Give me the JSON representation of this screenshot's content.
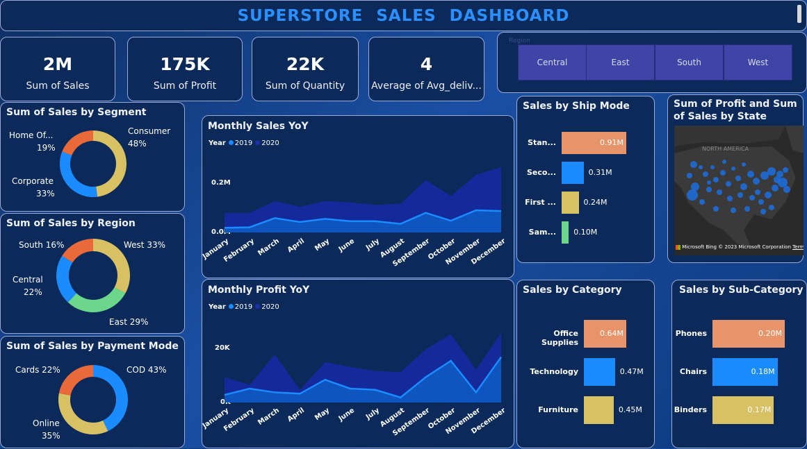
{
  "header": {
    "title": "SUPERSTORE SALES DASHBOARD"
  },
  "kpis": [
    {
      "value": "2M",
      "label": "Sum of Sales"
    },
    {
      "value": "175K",
      "label": "Sum of Profit"
    },
    {
      "value": "22K",
      "label": "Sum of Quantity"
    },
    {
      "value": "4",
      "label": "Average of Avg_deliv..."
    }
  ],
  "region_slicer": {
    "label": "Region",
    "options": [
      "Central",
      "East",
      "South",
      "West"
    ]
  },
  "segment_chart": {
    "title": "Sum of Sales by Segment",
    "slices": [
      {
        "name": "Consumer",
        "pct": "48%",
        "value": 48,
        "color": "#d8c064"
      },
      {
        "name": "Corporate",
        "pct": "33%",
        "value": 33,
        "color": "#1a8cff"
      },
      {
        "name": "Home Of...",
        "pct": "19%",
        "value": 19,
        "color": "#e8693a"
      }
    ]
  },
  "region_chart": {
    "title": "Sum of Sales by Region",
    "slices": [
      {
        "name": "West",
        "pct": "33%",
        "value": 33,
        "color": "#d8c064"
      },
      {
        "name": "East",
        "pct": "29%",
        "value": 29,
        "color": "#6cd68a"
      },
      {
        "name": "Central",
        "pct": "22%",
        "value": 22,
        "color": "#1a8cff"
      },
      {
        "name": "South",
        "pct": "16%",
        "value": 16,
        "color": "#e8693a"
      }
    ]
  },
  "payment_chart": {
    "title": "Sum of Sales by Payment Mode",
    "slices": [
      {
        "name": "COD",
        "pct": "43%",
        "value": 43,
        "color": "#1a8cff"
      },
      {
        "name": "Online",
        "pct": "35%",
        "value": 35,
        "color": "#d8c064"
      },
      {
        "name": "Cards",
        "pct": "22%",
        "value": 22,
        "color": "#e8693a"
      }
    ]
  },
  "monthly_sales": {
    "title": "Monthly Sales YoY",
    "legend_title": "Year",
    "series_names": [
      "2019",
      "2020"
    ],
    "months": [
      "January",
      "February",
      "March",
      "April",
      "May",
      "June",
      "July",
      "August",
      "September",
      "October",
      "November",
      "December"
    ],
    "y_ticks": [
      "0.2M",
      "0.0M"
    ],
    "series_2019": [
      0.018,
      0.02,
      0.055,
      0.04,
      0.052,
      0.043,
      0.043,
      0.033,
      0.075,
      0.045,
      0.085,
      0.082
    ],
    "series_2020": [
      0.075,
      0.075,
      0.12,
      0.098,
      0.12,
      0.115,
      0.105,
      0.11,
      0.2,
      0.14,
      0.22,
      0.25
    ]
  },
  "monthly_profit": {
    "title": "Monthly Profit YoY",
    "legend_title": "Year",
    "series_names": [
      "2019",
      "2020"
    ],
    "months": [
      "January",
      "February",
      "March",
      "April",
      "May",
      "June",
      "July",
      "August",
      "September",
      "October",
      "November",
      "December"
    ],
    "y_ticks": [
      "20K",
      "0K"
    ],
    "series_2019": [
      3000,
      5500,
      4000,
      3500,
      9000,
      5500,
      5000,
      2000,
      10000,
      16500,
      4000,
      18000
    ],
    "series_2020": [
      10000,
      7000,
      19000,
      5000,
      16000,
      14000,
      12500,
      12000,
      21000,
      27000,
      13000,
      27500
    ]
  },
  "ship_mode_chart": {
    "title": "Sales by Ship Mode",
    "bars": [
      {
        "name": "Stan...",
        "label": "0.91M",
        "value": 0.91,
        "color": "#e8946a"
      },
      {
        "name": "Seco...",
        "label": "0.31M",
        "value": 0.31,
        "color": "#1a8cff"
      },
      {
        "name": "First ...",
        "label": "0.24M",
        "value": 0.24,
        "color": "#d8c064"
      },
      {
        "name": "Sam...",
        "label": "0.10M",
        "value": 0.1,
        "color": "#6cd68a"
      }
    ]
  },
  "map_chart": {
    "title": "Sum of Profit and Sum of Sales by State",
    "region_label": "NORTH AMERICA",
    "attribution": "© 2023 Microsoft Corporation",
    "brand": "Microsoft Bing",
    "terms": "Terms"
  },
  "category_chart": {
    "title": "Sales by Category",
    "bars": [
      {
        "name": "Office Supplies",
        "label": "0.64M",
        "value": 0.64,
        "color": "#e8946a"
      },
      {
        "name": "Technology",
        "label": "0.47M",
        "value": 0.47,
        "color": "#1a8cff"
      },
      {
        "name": "Furniture",
        "label": "0.45M",
        "value": 0.45,
        "color": "#d8c064"
      }
    ]
  },
  "subcategory_chart": {
    "title": "Sales by Sub-Category",
    "bars": [
      {
        "name": "Phones",
        "label": "0.20M",
        "value": 0.2,
        "color": "#e8946a"
      },
      {
        "name": "Chairs",
        "label": "0.18M",
        "value": 0.18,
        "color": "#1a8cff"
      },
      {
        "name": "Binders",
        "label": "0.17M",
        "value": 0.17,
        "color": "#d8c064"
      }
    ]
  },
  "chart_data": [
    {
      "type": "pie",
      "title": "Sum of Sales by Segment",
      "categories": [
        "Consumer",
        "Corporate",
        "Home Of..."
      ],
      "values": [
        48,
        33,
        19
      ]
    },
    {
      "type": "pie",
      "title": "Sum of Sales by Region",
      "categories": [
        "West",
        "East",
        "Central",
        "South"
      ],
      "values": [
        33,
        29,
        22,
        16
      ]
    },
    {
      "type": "pie",
      "title": "Sum of Sales by Payment Mode",
      "categories": [
        "COD",
        "Online",
        "Cards"
      ],
      "values": [
        43,
        35,
        22
      ]
    },
    {
      "type": "area",
      "title": "Monthly Sales YoY",
      "x": [
        "January",
        "February",
        "March",
        "April",
        "May",
        "June",
        "July",
        "August",
        "September",
        "October",
        "November",
        "December"
      ],
      "series": [
        {
          "name": "2019",
          "values": [
            0.018,
            0.02,
            0.055,
            0.04,
            0.052,
            0.043,
            0.043,
            0.033,
            0.075,
            0.045,
            0.085,
            0.082
          ]
        },
        {
          "name": "2020",
          "values": [
            0.075,
            0.075,
            0.12,
            0.098,
            0.12,
            0.115,
            0.105,
            0.11,
            0.2,
            0.14,
            0.22,
            0.25
          ]
        }
      ]
    },
    {
      "type": "area",
      "title": "Monthly Profit YoY",
      "x": [
        "January",
        "February",
        "March",
        "April",
        "May",
        "June",
        "July",
        "August",
        "September",
        "October",
        "November",
        "December"
      ],
      "series": [
        {
          "name": "2019",
          "values": [
            3000,
            5500,
            4000,
            3500,
            9000,
            5500,
            5000,
            2000,
            10000,
            16500,
            4000,
            18000
          ]
        },
        {
          "name": "2020",
          "values": [
            10000,
            7000,
            19000,
            5000,
            16000,
            14000,
            12500,
            12000,
            21000,
            27000,
            13000,
            27500
          ]
        }
      ]
    },
    {
      "type": "bar",
      "title": "Sales by Ship Mode",
      "categories": [
        "Stan...",
        "Seco...",
        "First ...",
        "Sam..."
      ],
      "values": [
        0.91,
        0.31,
        0.24,
        0.1
      ]
    },
    {
      "type": "bar",
      "title": "Sales by Category",
      "categories": [
        "Office Supplies",
        "Technology",
        "Furniture"
      ],
      "values": [
        0.64,
        0.47,
        0.45
      ]
    },
    {
      "type": "bar",
      "title": "Sales by Sub-Category",
      "categories": [
        "Phones",
        "Chairs",
        "Binders"
      ],
      "values": [
        0.2,
        0.18,
        0.17
      ]
    }
  ]
}
